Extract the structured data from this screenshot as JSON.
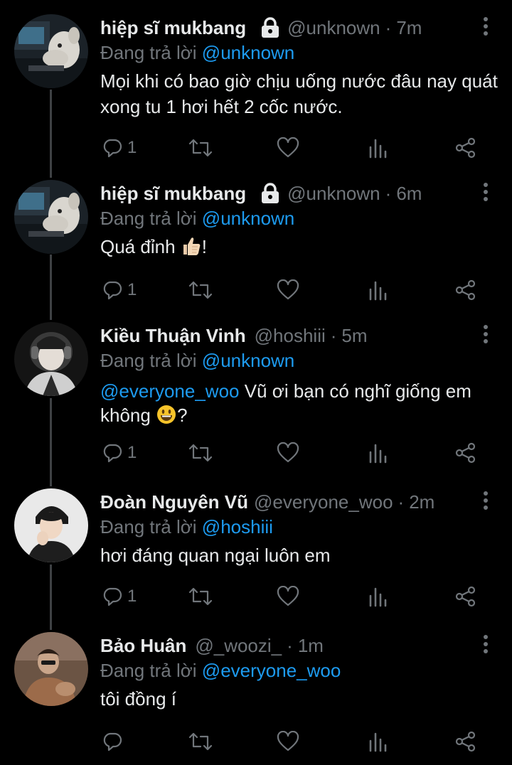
{
  "colors": {
    "background": "#000000",
    "text": "#e7e9ea",
    "muted": "#71767b",
    "link": "#1d9bf0"
  },
  "tweets": [
    {
      "name": "hiệp sĩ mukbang",
      "locked": true,
      "handle": "@unknown",
      "dot": "·",
      "time": "7m",
      "reply_prefix": "Đang trả lời",
      "reply_to": "@unknown",
      "text": "Mọi khi có bao giờ chịu uống nước đâu nay quát xong tu 1 hơi hết 2 cốc nước.",
      "reply_count": "1",
      "avatar_icon": "dog-at-computer-avatar"
    },
    {
      "name": "hiệp sĩ mukbang",
      "locked": true,
      "handle": "@unknown",
      "dot": "·",
      "time": "6m",
      "reply_prefix": "Đang trả lời",
      "reply_to": "@unknown",
      "text": "Quá đỉnh",
      "text_suffix": "!",
      "emoji": "thumbs-up-icon",
      "reply_count": "1",
      "avatar_icon": "dog-at-computer-avatar"
    },
    {
      "name": "Kiều Thuận Vinh",
      "locked": false,
      "handle": "@hoshiii",
      "dot": "·",
      "time": "5m",
      "reply_prefix": "Đang trả lời",
      "reply_to": "@unknown",
      "text_mention": "@everyone_woo",
      "text": "Vũ ơi bạn có nghĩ giống em",
      "text_line2": "không",
      "text_suffix": "?",
      "emoji": "grinning-face-icon",
      "reply_count": "1",
      "avatar_icon": "person-with-helmet-avatar"
    },
    {
      "name": "Đoàn Nguyên Vũ",
      "locked": false,
      "handle": "@everyone_woo",
      "dot": "·",
      "time": "2m",
      "reply_prefix": "Đang trả lời",
      "reply_to": "@hoshiii",
      "text": "hơi đáng quan ngại luôn em",
      "reply_count": "1",
      "avatar_icon": "person-portrait-avatar"
    },
    {
      "name": "Bảo Huân",
      "locked": false,
      "handle": "@_woozi_",
      "dot": "·",
      "time": "1m",
      "reply_prefix": "Đang trả lời",
      "reply_to": "@everyone_woo",
      "text": "tôi đồng í",
      "reply_count": "",
      "avatar_icon": "person-seated-avatar"
    }
  ]
}
